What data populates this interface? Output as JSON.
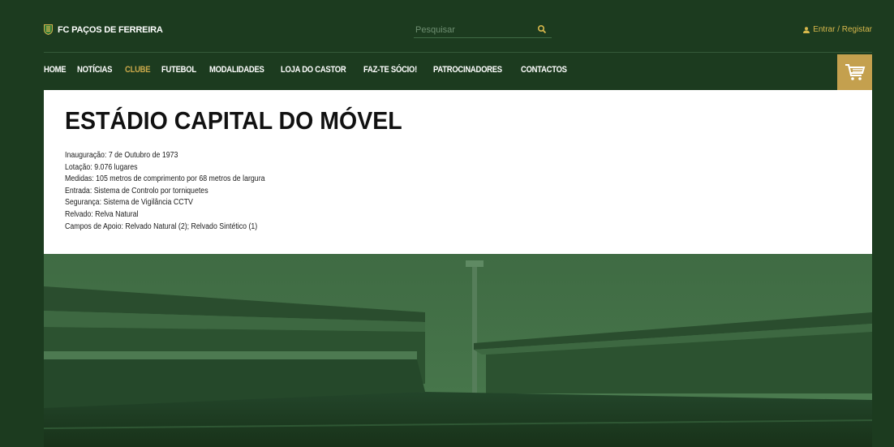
{
  "header": {
    "brand": "FC PAÇOS DE FERREIRA",
    "search_placeholder": "Pesquisar",
    "login": "Entrar / Registar"
  },
  "nav": {
    "items": [
      {
        "label": "HOME",
        "active": false
      },
      {
        "label": "NOTÍCIAS",
        "active": false
      },
      {
        "label": "CLUBE",
        "active": true
      },
      {
        "label": "FUTEBOL",
        "active": false
      },
      {
        "label": "MODALIDADES",
        "active": false
      },
      {
        "label": "LOJA DO CASTOR",
        "active": false
      },
      {
        "label": "FAZ-TE SÓCIO!",
        "active": false
      },
      {
        "label": "PATROCINADORES",
        "active": false
      },
      {
        "label": "CONTACTOS",
        "active": false
      }
    ]
  },
  "page": {
    "title": "ESTÁDIO CAPITAL DO MÓVEL",
    "facts": [
      "Inauguração: 7 de Outubro de 1973",
      "Lotação: 9.076 lugares",
      "Medidas: 105 metros de comprimento por 68 metros de largura",
      "Entrada: Sistema de Controlo por torniquetes",
      "Segurança: Sistema de Vigilância CCTV",
      "Relvado: Relva Natural",
      "Campos de Apoio: Relvado Natural (2); Relvado Sintético (1)"
    ]
  },
  "colors": {
    "background": "#1c3b1f",
    "accent_gold": "#c9a84a",
    "cart_bg": "#c4a04e",
    "image_tint": "#2f5a33"
  },
  "icons": {
    "crest": "club-crest-icon",
    "search": "search-icon",
    "user": "user-icon",
    "cart": "shopping-cart-icon"
  }
}
